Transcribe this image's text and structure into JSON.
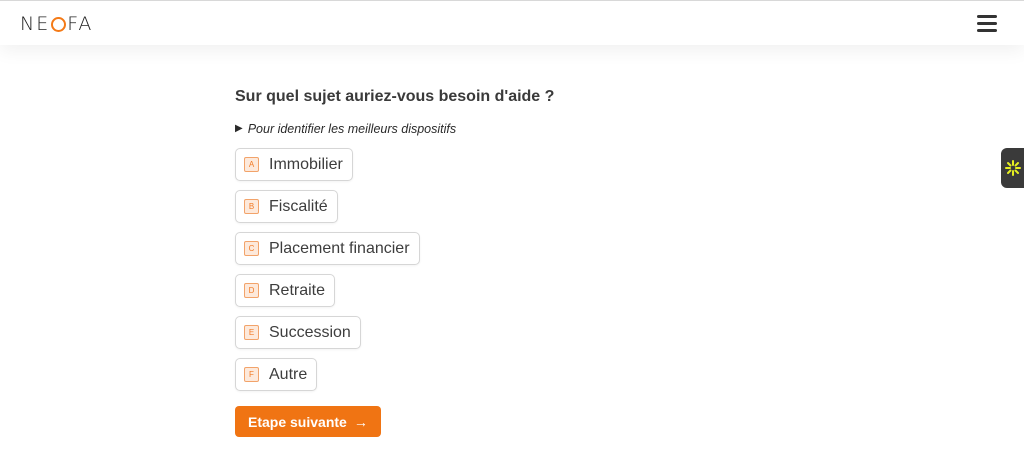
{
  "header": {
    "logo_left": "NE",
    "logo_right": "FA",
    "brand_color": "#f47a17"
  },
  "form": {
    "question": "Sur quel sujet auriez-vous besoin d'aide ?",
    "hint": "Pour identifier les meilleurs dispositifs",
    "options": [
      {
        "key": "A",
        "label": "Immobilier"
      },
      {
        "key": "B",
        "label": "Fiscalité"
      },
      {
        "key": "C",
        "label": "Placement financier"
      },
      {
        "key": "D",
        "label": "Retraite"
      },
      {
        "key": "E",
        "label": "Succession"
      },
      {
        "key": "F",
        "label": "Autre"
      }
    ],
    "next_label": "Etape suivante",
    "next_arrow": "→"
  },
  "accent_color": "#f07413",
  "icons": {
    "menu": "hamburger-menu-icon",
    "widget": "accessibility-widget-icon"
  }
}
